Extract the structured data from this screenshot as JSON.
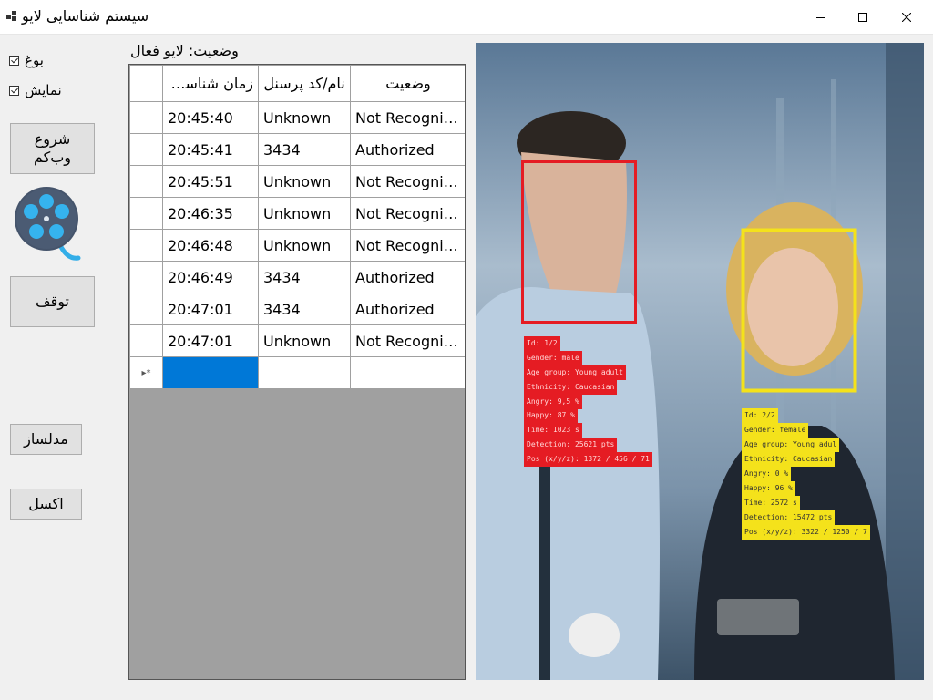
{
  "window": {
    "title": "سیستم شناسایی لایو"
  },
  "sidebar": {
    "checkbox_1": {
      "label": "بوغ",
      "checked": true
    },
    "checkbox_2": {
      "label": "نمایش",
      "checked": true
    },
    "start_webcam_line1": "شروع",
    "start_webcam_line2": "وب‌کم",
    "reel_icon": "film-reel-icon",
    "stop_label": "توقف",
    "model_builder_label": "مدلساز",
    "excel_label": "اکسل"
  },
  "status": {
    "text": "وضعیت: لایو فعال"
  },
  "grid": {
    "columns": [
      "زمان شناسایی",
      "نام/کد پرسنل",
      "وضعیت"
    ],
    "rows": [
      {
        "time": "20:45:40",
        "id": "Unknown",
        "status": "Not Recogniz..."
      },
      {
        "time": "20:45:41",
        "id": "3434",
        "status": "Authorized"
      },
      {
        "time": "20:45:51",
        "id": "Unknown",
        "status": "Not Recogniz..."
      },
      {
        "time": "20:46:35",
        "id": "Unknown",
        "status": "Not Recogniz..."
      },
      {
        "time": "20:46:48",
        "id": "Unknown",
        "status": "Not Recogniz..."
      },
      {
        "time": "20:46:49",
        "id": "3434",
        "status": "Authorized"
      },
      {
        "time": "20:47:01",
        "id": "3434",
        "status": "Authorized"
      },
      {
        "time": "20:47:01",
        "id": "Unknown",
        "status": "Not Recogniz..."
      }
    ],
    "new_row_marker": "▸*"
  },
  "video": {
    "face_1": {
      "box_color": "#e51c23",
      "lines": [
        "Id: 1/2",
        "Gender: male",
        "Age group: Young adult",
        "Ethnicity: Caucasian",
        "Angry: 9,5 %",
        "Happy: 87 %",
        "Time: 1023 s",
        "Detection: 25621 pts",
        "Pos (x/y/z): 1372 / 456 / 71"
      ]
    },
    "face_2": {
      "box_color": "#f4e21b",
      "lines": [
        "Id: 2/2",
        "Gender: female",
        "Age group: Young adul",
        "Ethnicity: Caucasian",
        "Angry: 0 %",
        "Happy: 96 %",
        "Time: 2572 s",
        "Detection: 15472 pts",
        "Pos (x/y/z): 3322 / 1250 / 7"
      ]
    }
  }
}
